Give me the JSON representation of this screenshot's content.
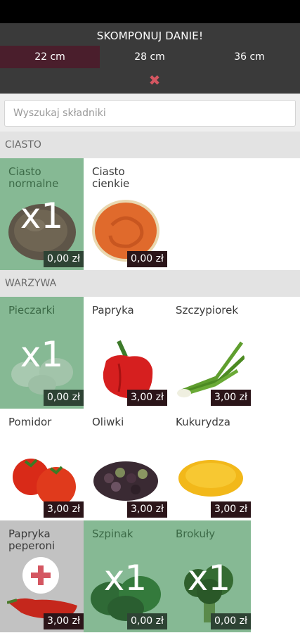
{
  "header": {
    "title": "SKOMPONUJ DANIE!",
    "sizes": [
      {
        "label": "22 cm",
        "active": true
      },
      {
        "label": "28 cm",
        "active": false
      },
      {
        "label": "36 cm",
        "active": false
      }
    ],
    "close_icon": "close-x-icon"
  },
  "search": {
    "placeholder": "Wyszukaj składniki",
    "value": ""
  },
  "sections": [
    {
      "title": "CIASTO",
      "items": [
        {
          "name": "Ciasto normalne",
          "price": "0,00 zł",
          "state": "selected",
          "qty": "x1",
          "icon": "dough-icon"
        },
        {
          "name": "Ciasto cienkie",
          "price": "0,00 zł",
          "state": "normal",
          "icon": "thin-crust-icon"
        }
      ]
    },
    {
      "title": "WARZYWA",
      "items": [
        {
          "name": "Pieczarki",
          "price": "0,00 zł",
          "state": "selected",
          "qty": "x1",
          "icon": "mushroom-icon"
        },
        {
          "name": "Papryka",
          "price": "3,00 zł",
          "state": "normal",
          "icon": "pepper-icon"
        },
        {
          "name": "Szczypiorek",
          "price": "3,00 zł",
          "state": "normal",
          "icon": "chives-icon"
        },
        {
          "name": "Pomidor",
          "price": "3,00 zł",
          "state": "normal",
          "icon": "tomato-icon"
        },
        {
          "name": "Oliwki",
          "price": "3,00 zł",
          "state": "normal",
          "icon": "olives-icon"
        },
        {
          "name": "Kukurydza",
          "price": "3,00 zł",
          "state": "normal",
          "icon": "corn-icon"
        },
        {
          "name": "Papryka peperoni",
          "price": "3,00 zł",
          "state": "disabled",
          "icon": "peperoni-icon",
          "add_icon": "plus-icon"
        },
        {
          "name": "Szpinak",
          "price": "0,00 zł",
          "state": "selected",
          "qty": "x1",
          "icon": "spinach-icon"
        },
        {
          "name": "Brokuły",
          "price": "0,00 zł",
          "state": "selected",
          "qty": "x1",
          "icon": "broccoli-icon"
        }
      ]
    }
  ],
  "colors": {
    "header_bg": "#3a3a3a",
    "active_size": "#4a1e2c",
    "selected_tile": "#86b994",
    "accent_red": "#d45661",
    "price_bg": "#2b1519"
  }
}
